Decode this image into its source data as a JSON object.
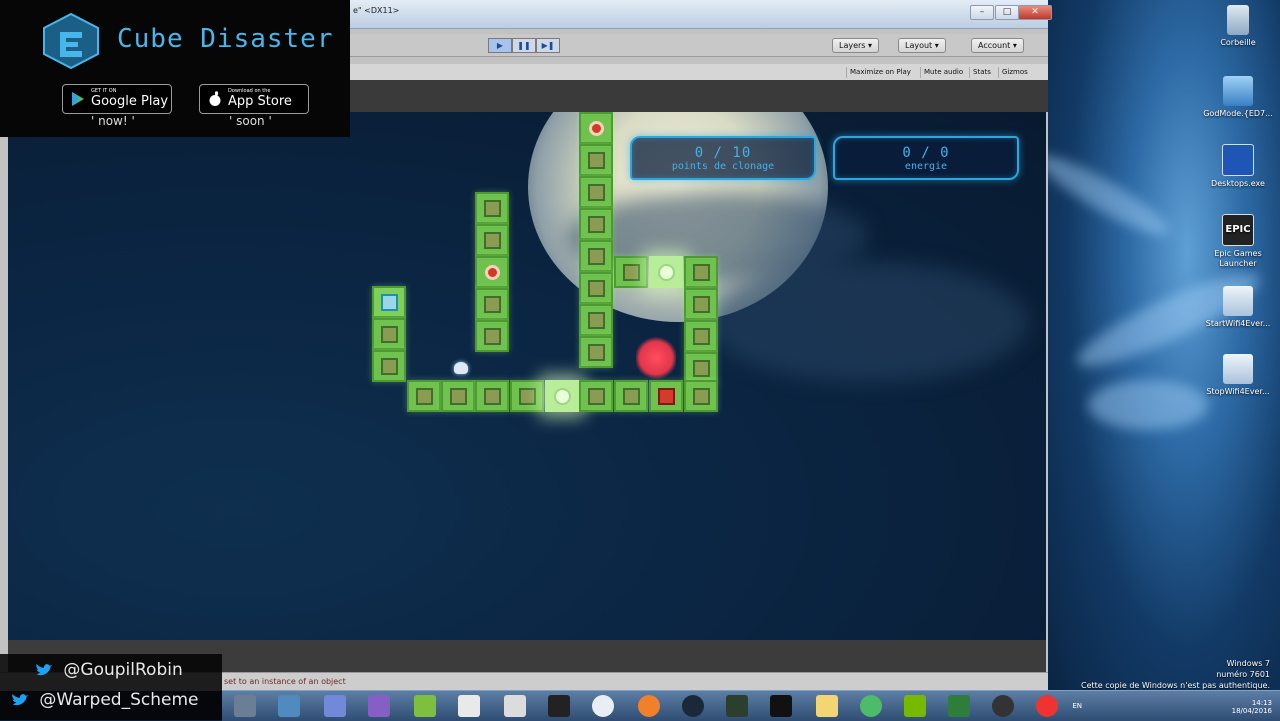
{
  "promo": {
    "game_name": "Cube Disaster",
    "google_play_small": "GET IT ON",
    "google_play_label": "Google Play",
    "google_play_tag": "' now! '",
    "app_store_small": "Download on the",
    "app_store_label": "App Store",
    "app_store_tag": "' soon '"
  },
  "social": {
    "handle_1": "@GoupilRobin",
    "handle_2": "@Warped_Scheme"
  },
  "unity": {
    "window_title": "e\" <DX11>",
    "toolbar": {
      "layers": "Layers",
      "layout": "Layout",
      "account": "Account"
    },
    "game_tab": {
      "maximize": "Maximize on Play",
      "mute": "Mute audio",
      "stats": "Stats",
      "gizmos": "Gizmos"
    },
    "status_message": "set to an instance of an object"
  },
  "hud": {
    "clone_value": "0 / 10",
    "clone_label": "points de clonage",
    "energy_value": "0 / 0",
    "energy_label": "energie"
  },
  "desktop": {
    "icons": [
      {
        "label": "Corbeille",
        "icon": "recycle-bin-icon"
      },
      {
        "label": "GodMode.{ED7...",
        "icon": "godmode-icon"
      },
      {
        "label": "Desktops.exe",
        "icon": "desktops-icon"
      },
      {
        "label": "Epic Games Launcher",
        "icon": "epic-games-icon"
      },
      {
        "label": "StartWifi4Ever...",
        "icon": "wifi-start-icon"
      },
      {
        "label": "StopWifi4Ever...",
        "icon": "wifi-stop-icon"
      }
    ],
    "windows_line_1": "Windows 7",
    "windows_line_2": "numéro 7601",
    "windows_line_3": "Cette copie de Windows n'est pas authentique."
  },
  "taskbar": {
    "lang": "EN",
    "time": "14:13",
    "date": "18/04/2016"
  },
  "colors": {
    "accent": "#47b6ea",
    "block": "#6fc24e",
    "hud": "#3fb3ea"
  }
}
